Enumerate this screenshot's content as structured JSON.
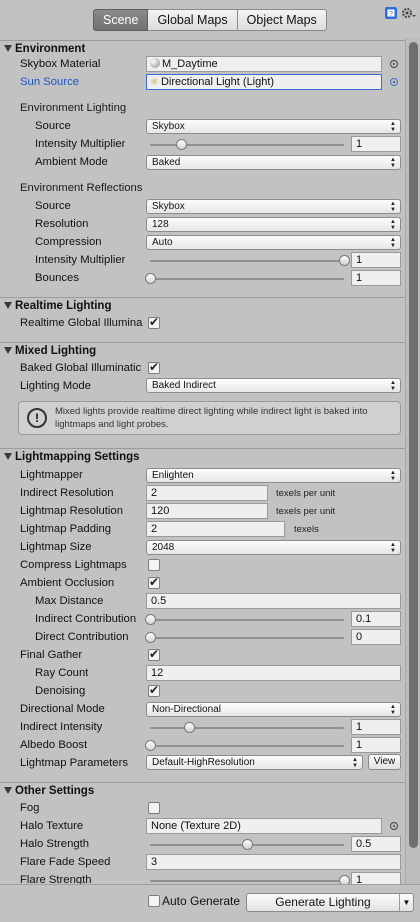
{
  "tabs": [
    "Scene",
    "Global Maps",
    "Object Maps"
  ],
  "toolbar_icons": [
    "help-book-icon",
    "settings-gear-icon"
  ],
  "environment": {
    "title": "Environment",
    "skybox_label": "Skybox Material",
    "skybox_value": "M_Daytime",
    "sun_label": "Sun Source",
    "sun_value": "Directional Light (Light)",
    "lighting_header": "Environment Lighting",
    "source_label": "Source",
    "source_value": "Skybox",
    "intensity_label": "Intensity Multiplier",
    "intensity_value": "1",
    "intensity_level": 0.16,
    "ambient_label": "Ambient Mode",
    "ambient_value": "Baked",
    "reflections_header": "Environment Reflections",
    "rsource_label": "Source",
    "rsource_value": "Skybox",
    "resolution_label": "Resolution",
    "resolution_value": "128",
    "compression_label": "Compression",
    "compression_value": "Auto",
    "rintensity_label": "Intensity Multiplier",
    "rintensity_value": "1",
    "rintensity_level": 1.0,
    "bounces_label": "Bounces",
    "bounces_value": "1",
    "bounces_level": 0.0
  },
  "realtime": {
    "title": "Realtime Lighting",
    "gi_label": "Realtime Global Illumina",
    "gi_checked": true
  },
  "mixed": {
    "title": "Mixed Lighting",
    "gi_label": "Baked Global Illuminatic",
    "gi_checked": true,
    "mode_label": "Lighting Mode",
    "mode_value": "Baked Indirect",
    "help_text": "Mixed lights provide realtime direct lighting while indirect light is baked into lightmaps and light probes."
  },
  "lightmapping": {
    "title": "Lightmapping Settings",
    "lightmapper_label": "Lightmapper",
    "lightmapper_value": "Enlighten",
    "indirect_res_label": "Indirect Resolution",
    "indirect_res_value": "2",
    "indirect_res_unit": "texels per unit",
    "lm_res_label": "Lightmap Resolution",
    "lm_res_value": "120",
    "lm_res_unit": "texels per unit",
    "padding_label": "Lightmap Padding",
    "padding_value": "2",
    "padding_unit": "texels",
    "size_label": "Lightmap Size",
    "size_value": "2048",
    "compress_label": "Compress Lightmaps",
    "compress_checked": false,
    "ao_label": "Ambient Occlusion",
    "ao_checked": true,
    "maxdist_label": "Max Distance",
    "maxdist_value": "0.5",
    "indirect_contrib_label": "Indirect Contribution",
    "indirect_contrib_value": "0.1",
    "indirect_contrib_level": 0.0,
    "direct_contrib_label": "Direct Contribution",
    "direct_contrib_value": "0",
    "direct_contrib_level": 0.0,
    "final_gather_label": "Final Gather",
    "final_gather_checked": true,
    "ray_label": "Ray Count",
    "ray_value": "12",
    "denoise_label": "Denoising",
    "denoise_checked": true,
    "dir_mode_label": "Directional Mode",
    "dir_mode_value": "Non-Directional",
    "ind_intensity_label": "Indirect Intensity",
    "ind_intensity_value": "1",
    "ind_intensity_level": 0.2,
    "albedo_label": "Albedo Boost",
    "albedo_value": "1",
    "albedo_level": 0.0,
    "params_label": "Lightmap Parameters",
    "params_value": "Default-HighResolution",
    "view_label": "View"
  },
  "other": {
    "title": "Other Settings",
    "fog_label": "Fog",
    "fog_checked": false,
    "halo_tex_label": "Halo Texture",
    "halo_tex_value": "None (Texture 2D)",
    "halo_str_label": "Halo Strength",
    "halo_str_value": "0.5",
    "halo_str_level": 0.5,
    "flare_fade_label": "Flare Fade Speed",
    "flare_fade_value": "3",
    "flare_str_label": "Flare Strength",
    "flare_str_value": "1"
  },
  "footer": {
    "auto_label": "Auto Generate",
    "auto_checked": false,
    "generate_label": "Generate Lighting"
  }
}
